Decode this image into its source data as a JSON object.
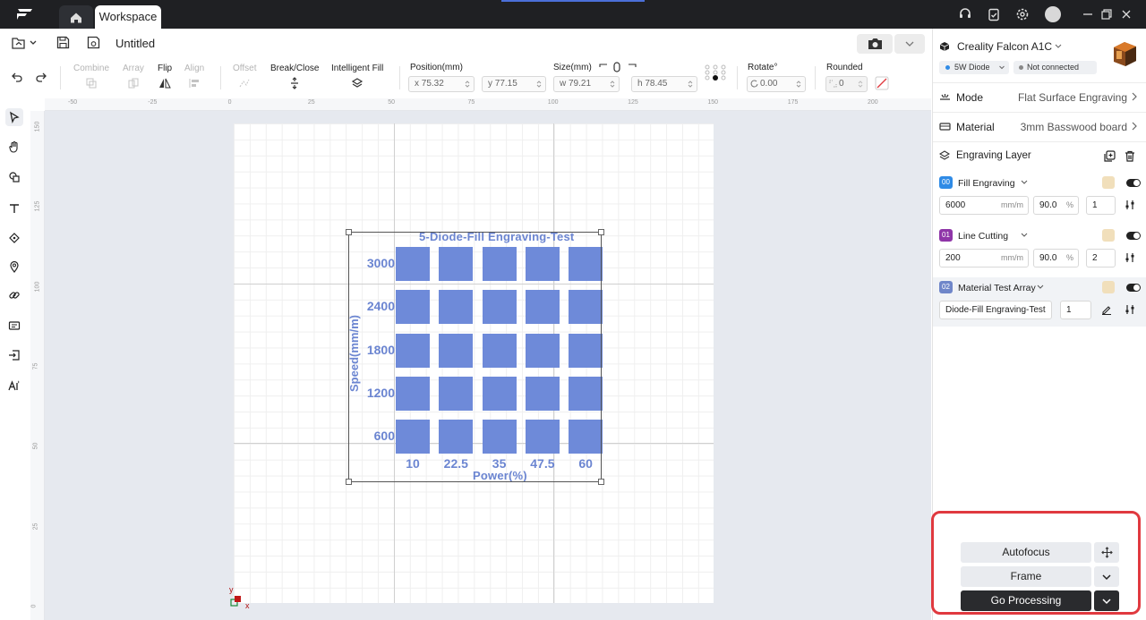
{
  "titlebar": {
    "tab_workspace": "Workspace"
  },
  "file": {
    "title": "Untitled"
  },
  "toolbar": {
    "combine": "Combine",
    "array": "Array",
    "flip": "Flip",
    "align": "Align",
    "offset": "Offset",
    "break_close": "Break/Close",
    "intelligent_fill": "Intelligent Fill",
    "position_label": "Position(mm)",
    "pos_x": "x 75.32",
    "pos_y": "y 77.15",
    "size_label": "Size(mm)",
    "size_w": "w 79.21",
    "size_h": "h 78.45",
    "rotate_label": "Rotate°",
    "rotate_value": "0.00",
    "rounded_label": "Rounded",
    "rounded_value": "0"
  },
  "rulers": {
    "top": [
      "-50",
      "-25",
      "0",
      "25",
      "50",
      "75",
      "100",
      "125",
      "150",
      "175",
      "200"
    ],
    "left": [
      "150",
      "125",
      "100",
      "75",
      "50",
      "25",
      "0"
    ]
  },
  "test_array": {
    "title": "5-Diode-Fill Engraving-Test",
    "y_axis_label": "Speed(mm/m)",
    "x_axis_label": "Power(%)",
    "rows": [
      "3000",
      "2400",
      "1800",
      "1200",
      "600"
    ],
    "cols": [
      "10",
      "22.5",
      "35",
      "47.5",
      "60"
    ],
    "cell_color": "#6e8ad9"
  },
  "origin": {
    "x_label": "x",
    "y_label": "y"
  },
  "panel": {
    "device_name": "Creality Falcon A1C",
    "laser_pill": "5W Diode",
    "connection_pill": "Not connected",
    "mode_label": "Mode",
    "mode_value": "Flat Surface Engraving",
    "material_label": "Material",
    "material_value": "3mm Basswood board",
    "layer_header": "Engraving Layer",
    "layers": [
      {
        "badge": "00",
        "name": "Fill Engraving",
        "speed": "6000",
        "speed_unit": "mm/m",
        "power": "90.0",
        "power_unit": "%",
        "passes": "1"
      },
      {
        "badge": "01",
        "name": "Line Cutting",
        "speed": "200",
        "speed_unit": "mm/m",
        "power": "90.0",
        "power_unit": "%",
        "passes": "2"
      },
      {
        "badge": "02",
        "name": "Material Test Array",
        "preset": "Diode-Fill Engraving-Test",
        "passes": "1"
      }
    ]
  },
  "actions": {
    "autofocus": "Autofocus",
    "frame": "Frame",
    "go_processing": "Go Processing"
  },
  "colors": {
    "accent_red": "#e0393f",
    "array_blue": "#6e8ad9",
    "badge_blue": "#2f8be6",
    "badge_purple": "#8f35a8",
    "badge_slate": "#6f86c9"
  }
}
